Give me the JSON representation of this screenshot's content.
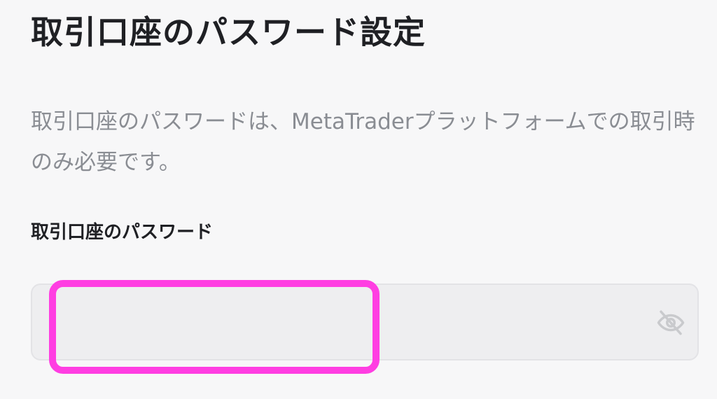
{
  "page": {
    "title": "取引口座のパスワード設定",
    "description": "取引口座のパスワードは、MetaTraderプラットフォームでの取引時のみ必要です。"
  },
  "password_field": {
    "label": "取引口座のパスワード",
    "value": "",
    "placeholder": "",
    "toggle_icon": "eye-off-icon"
  },
  "colors": {
    "highlight": "#ff3ee2",
    "background": "#f7f7f8",
    "field_background": "#eeeef0",
    "text_primary": "#1f2024",
    "text_secondary": "#8a8d93"
  }
}
